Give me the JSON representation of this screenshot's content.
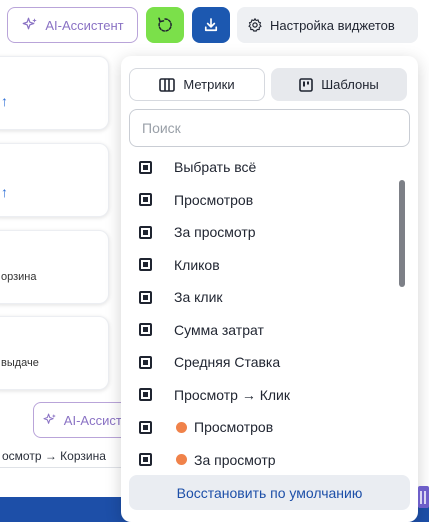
{
  "toolbar": {
    "ai_assistant_label": "AI-Ассистент",
    "widget_settings_label": "Настройка виджетов"
  },
  "background": {
    "cards": [
      {
        "text": ""
      },
      {
        "text": ""
      },
      {
        "text": "орзина"
      },
      {
        "text": "выдаче"
      }
    ],
    "ai_assistant_label": "AI-Ассистент",
    "funnel_text": "осмотр → Корзина"
  },
  "panel": {
    "tabs": [
      {
        "label": "Метрики",
        "icon": "columns-icon",
        "active": false
      },
      {
        "label": "Шаблоны",
        "icon": "template-icon",
        "active": true
      }
    ],
    "search": {
      "placeholder": "Поиск",
      "value": ""
    },
    "items": [
      {
        "label": "Выбрать всё",
        "checked": true,
        "dot": false
      },
      {
        "label": "Просмотров",
        "checked": true,
        "dot": false
      },
      {
        "label": "За просмотр",
        "checked": true,
        "dot": false
      },
      {
        "label": "Кликов",
        "checked": true,
        "dot": false
      },
      {
        "label": "За клик",
        "checked": true,
        "dot": false
      },
      {
        "label": "Сумма затрат",
        "checked": true,
        "dot": false
      },
      {
        "label": "Средняя Ставка",
        "checked": true,
        "dot": false
      },
      {
        "label": "Просмотр → Клик",
        "checked": true,
        "dot": false
      },
      {
        "label": "Просмотров",
        "checked": true,
        "dot": true
      },
      {
        "label": "За просмотр",
        "checked": true,
        "dot": true
      }
    ],
    "restore_label": "Восстановить по умолчанию"
  },
  "colors": {
    "accent_blue": "#1d4fa8",
    "refresh_green": "#7be04a",
    "ai_purple": "#8a72c4",
    "dot_orange": "#f0824a"
  }
}
